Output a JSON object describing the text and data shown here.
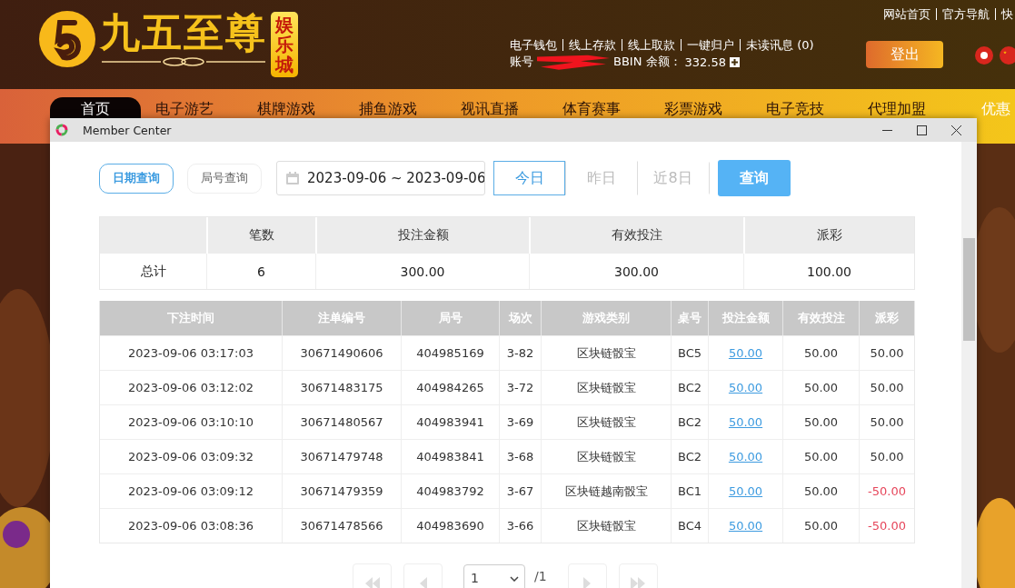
{
  "site_header": {
    "logo": {
      "name": "九五至尊",
      "badge": "娱乐城"
    },
    "top_links": [
      "网站首页",
      "官方导航",
      "快"
    ],
    "account_links": [
      "电子钱包",
      "线上存款",
      "线上取款",
      "一键归户",
      "未读讯息 (0)"
    ],
    "account_label": "账号",
    "balance_label": "BBIN 余额：",
    "balance": "332.58",
    "logout": "登出"
  },
  "nav": [
    {
      "label": "首页",
      "selected": true,
      "kind": "game"
    },
    {
      "label": "电子游艺",
      "selected": false,
      "kind": "game"
    },
    {
      "label": "棋牌游戏",
      "selected": false,
      "kind": "game"
    },
    {
      "label": "捕鱼游戏",
      "selected": false,
      "kind": "game"
    },
    {
      "label": "视讯直播",
      "selected": false,
      "kind": "game"
    },
    {
      "label": "体育赛事",
      "selected": false,
      "kind": "game"
    },
    {
      "label": "彩票游戏",
      "selected": false,
      "kind": "game"
    },
    {
      "label": "电子竞技",
      "selected": false,
      "kind": "game"
    },
    {
      "label": "代理加盟",
      "selected": false,
      "kind": "game"
    },
    {
      "label": "优惠",
      "selected": false,
      "kind": "promo"
    }
  ],
  "window": {
    "title": "Member Center"
  },
  "query_tabs": [
    {
      "label": "日期查询",
      "selected": true
    },
    {
      "label": "局号查询",
      "selected": false
    }
  ],
  "date_range": "2023-09-06 ~ 2023-09-06",
  "quick_ranges": [
    {
      "label": "今日",
      "selected": true
    },
    {
      "label": "昨日",
      "selected": false
    },
    {
      "label": "近8日",
      "selected": false
    }
  ],
  "search_button": "查询",
  "summary": {
    "columns": [
      "笔数",
      "投注金额",
      "有效投注",
      "派彩"
    ],
    "row": {
      "label": "总计",
      "values": [
        "6",
        "300.00",
        "300.00",
        "100.00"
      ]
    }
  },
  "bets": {
    "columns": [
      "下注时间",
      "注单编号",
      "局号",
      "场次",
      "游戏类别",
      "桌号",
      "投注金额",
      "有效投注",
      "派彩"
    ],
    "rows": [
      {
        "time": "2023-09-06 03:17:03",
        "ticket": "30671490606",
        "round_no": "404985169",
        "session": "3-82",
        "game": "区块链骰宝",
        "table": "BC5",
        "stake": "50.00",
        "valid": "50.00",
        "payout": "50.00",
        "loss": false
      },
      {
        "time": "2023-09-06 03:12:02",
        "ticket": "30671483175",
        "round_no": "404984265",
        "session": "3-72",
        "game": "区块链骰宝",
        "table": "BC2",
        "stake": "50.00",
        "valid": "50.00",
        "payout": "50.00",
        "loss": false
      },
      {
        "time": "2023-09-06 03:10:10",
        "ticket": "30671480567",
        "round_no": "404983941",
        "session": "3-69",
        "game": "区块链骰宝",
        "table": "BC2",
        "stake": "50.00",
        "valid": "50.00",
        "payout": "50.00",
        "loss": false
      },
      {
        "time": "2023-09-06 03:09:32",
        "ticket": "30671479748",
        "round_no": "404983841",
        "session": "3-68",
        "game": "区块链骰宝",
        "table": "BC2",
        "stake": "50.00",
        "valid": "50.00",
        "payout": "50.00",
        "loss": false
      },
      {
        "time": "2023-09-06 03:09:12",
        "ticket": "30671479359",
        "round_no": "404983792",
        "session": "3-67",
        "game": "区块链越南骰宝",
        "table": "BC1",
        "stake": "50.00",
        "valid": "50.00",
        "payout": "-50.00",
        "loss": true
      },
      {
        "time": "2023-09-06 03:08:36",
        "ticket": "30671478566",
        "round_no": "404983690",
        "session": "3-66",
        "game": "区块链骰宝",
        "table": "BC4",
        "stake": "50.00",
        "valid": "50.00",
        "payout": "-50.00",
        "loss": true
      }
    ]
  },
  "pagination": {
    "page": "1",
    "total": "/1"
  }
}
